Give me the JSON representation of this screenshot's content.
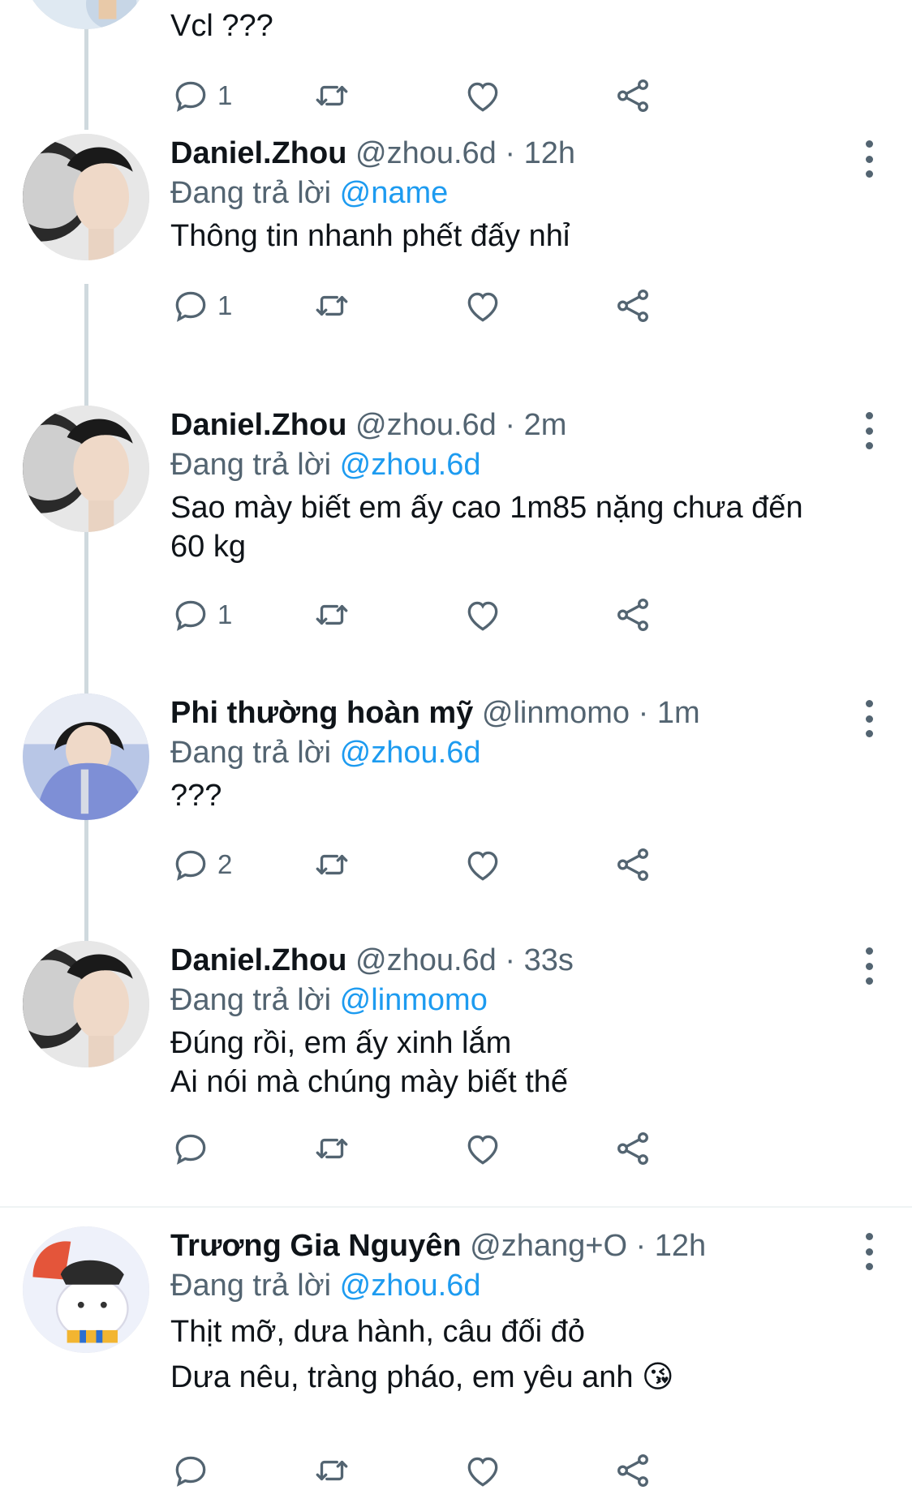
{
  "top_tweet": {
    "text_lines": [
      "Vcl ???"
    ],
    "reply_count": "1"
  },
  "tweets": [
    {
      "name": "Daniel.Zhou",
      "handle": "@zhou.6d",
      "time": "12h",
      "reply_prefix": "Đang trả lời ",
      "reply_to": "@name",
      "text_lines": [
        "Thông tin nhanh phết đấy nhỉ"
      ],
      "reply_count": "1"
    },
    {
      "name": "Daniel.Zhou",
      "handle": "@zhou.6d",
      "time": "2m",
      "reply_prefix": "Đang trả lời ",
      "reply_to": "@zhou.6d",
      "text_lines": [
        "Sao mày biết em ấy cao 1m85 nặng chưa đến",
        "60 kg"
      ],
      "reply_count": "1"
    },
    {
      "name": "Phi thường hoàn mỹ",
      "handle": "@linmomo",
      "time": "1m",
      "reply_prefix": "Đang trả lời ",
      "reply_to": "@zhou.6d",
      "text_lines": [
        "???"
      ],
      "reply_count": "2"
    },
    {
      "name": "Daniel.Zhou",
      "handle": "@zhou.6d",
      "time": "33s",
      "reply_prefix": "Đang trả lời ",
      "reply_to": "@linmomo",
      "text_lines": [
        "Đúng rồi, em ấy xinh lắm",
        "Ai nói mà chúng mày biết thế"
      ],
      "reply_count": ""
    },
    {
      "name": "Trương Gia Nguyên",
      "handle": "@zhang+O",
      "time": "12h",
      "reply_prefix": "Đang trả lời ",
      "reply_to": "@zhou.6d",
      "text_lines": [
        "Thịt mỡ, dưa hành, câu đối đỏ",
        "Dưa nêu, tràng pháo, em yêu anh 😘"
      ],
      "reply_count": ""
    }
  ],
  "separator": " · ",
  "icons": {
    "reply": "comment-icon",
    "retweet": "retweet-icon",
    "like": "heart-icon",
    "share": "share-icon",
    "more": "more-vertical-icon"
  },
  "colors": {
    "link": "#1d9bf0",
    "muted": "#536471",
    "thread_line": "#cfd9de"
  }
}
